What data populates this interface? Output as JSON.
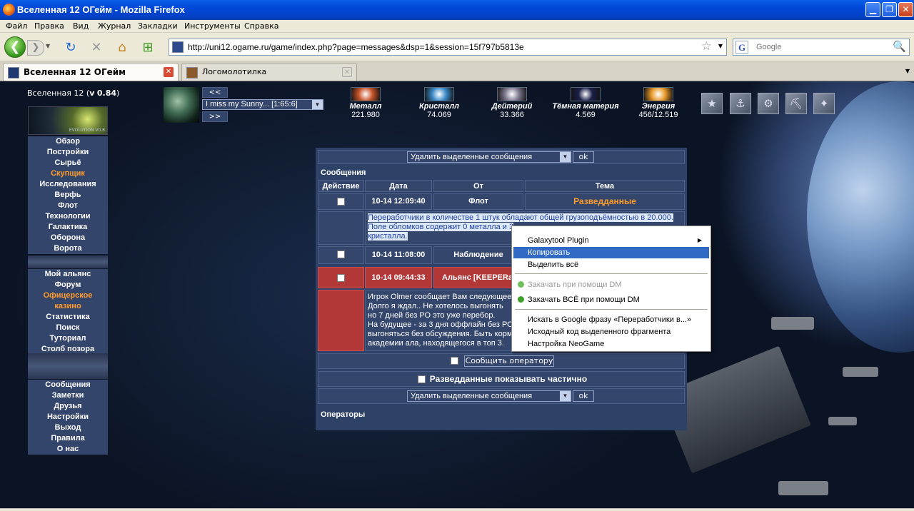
{
  "window": {
    "title": "Вселенная 12 ОГейм - Mozilla Firefox"
  },
  "menubar": [
    "Файл",
    "Правка",
    "Вид",
    "Журнал",
    "Закладки",
    "Инструменты",
    "Справка"
  ],
  "url": "http://uni12.ogame.ru/game/index.php?page=messages&dsp=1&session=15f797b5813e",
  "search_placeholder": "Google",
  "tabs": [
    {
      "label": "Вселенная 12 ОГейм",
      "active": true
    },
    {
      "label": "Логомолотилка",
      "active": false
    }
  ],
  "game": {
    "universe_label": "Вселенная 12 (",
    "version_v": "v",
    "version": "0.84",
    "version_close": ")",
    "logo_text": "EVOLUTION V0.8",
    "menu1": [
      {
        "label": "Обзор"
      },
      {
        "label": "Постройки"
      },
      {
        "label": "Сырьё"
      },
      {
        "label": "Скупщик",
        "highlight": true
      },
      {
        "label": "Исследования"
      },
      {
        "label": "Верфь"
      },
      {
        "label": "Флот"
      },
      {
        "label": "Технологии"
      },
      {
        "label": "Галактика"
      },
      {
        "label": "Оборона"
      },
      {
        "label": "Ворота"
      }
    ],
    "menu2": [
      {
        "label": "Мой альянс"
      },
      {
        "label": "Форум"
      },
      {
        "label": "Офицерское",
        "highlight": true
      },
      {
        "label": "казино",
        "highlight": true
      },
      {
        "label": "Статистика"
      },
      {
        "label": "Поиск"
      },
      {
        "label": "Туториал"
      },
      {
        "label": "Столб позора"
      }
    ],
    "menu3": [
      {
        "label": "Сообщения"
      },
      {
        "label": "Заметки"
      },
      {
        "label": "Друзья"
      },
      {
        "label": "Настройки"
      },
      {
        "label": "Выход"
      },
      {
        "label": "Правила"
      },
      {
        "label": "О нас"
      }
    ],
    "planet_prev": "<<",
    "planet_next": ">>",
    "planet_selected": "I miss my Sunny... [1:65:6]",
    "resources": [
      {
        "name": "Металл",
        "value": "221.980",
        "color": "#c8542a"
      },
      {
        "name": "Кристалл",
        "value": "74.069",
        "color": "#3a8ac8"
      },
      {
        "name": "Дейтерий",
        "value": "33.366",
        "color": "#7f7a90"
      },
      {
        "name": "Тёмная материя",
        "value": "4.569",
        "color": "#1a1f48"
      },
      {
        "name": "Энергия",
        "value": "456/12.519",
        "color": "#e89a2a"
      }
    ],
    "officer_icons": [
      "commander-icon",
      "admiral-icon",
      "engineer-icon",
      "geologist-icon",
      "technocrat-icon"
    ]
  },
  "messages": {
    "action_select": "Удалить выделенные сообщения",
    "ok": "ok",
    "section_title": "Сообщения",
    "columns": [
      "Действие",
      "Дата",
      "От",
      "Тема"
    ],
    "rows": [
      {
        "date": "10-14 12:09:40",
        "from": "Флот",
        "subject": "Разведданные",
        "subject_color": "#ff9c2a",
        "body": [
          "Переработчики в количестве 1 штук обладают общей грузоподъёмностью в 20.000.",
          "Поле обломков содержит 0 металла и 3",
          "кристалла."
        ]
      },
      {
        "date": "10-14 11:08:00",
        "from": "Наблюдение",
        "subject": ""
      },
      {
        "date": "10-14 09:44:33",
        "from": "Альянс [KEEPERa",
        "subject": "",
        "red": true,
        "body": [
          "Игрок Olmer сообщает Вам следующее:",
          "Долго я ждал.. Не хотелось выгонять",
          "но 7 дней без РО это уже перебор.",
          "На будущее - за 3 дня оффлайн без РО",
          "выгоняться без обсуждения. Быть корм",
          "академии ала, находящегося в топ 3."
        ]
      }
    ],
    "report_operator": "Сообщить оператору",
    "partial_intel": "Разведданные показывать частично",
    "operators_title": "Операторы"
  },
  "context_menu": {
    "items": [
      {
        "label": "Galaxytool Plugin",
        "submenu": true
      },
      {
        "label": "Копировать",
        "highlighted": true
      },
      {
        "label": "Выделить всё"
      },
      {
        "label": "Закачать при помощи DM",
        "disabled": true
      },
      {
        "label": "Закачать ВСЁ при помощи DM"
      },
      {
        "label": "Искать в Google фразу «Переработчики в...»"
      },
      {
        "label": "Исходный код выделенного фрагмента"
      },
      {
        "label": "Настройка NeoGame"
      }
    ]
  }
}
